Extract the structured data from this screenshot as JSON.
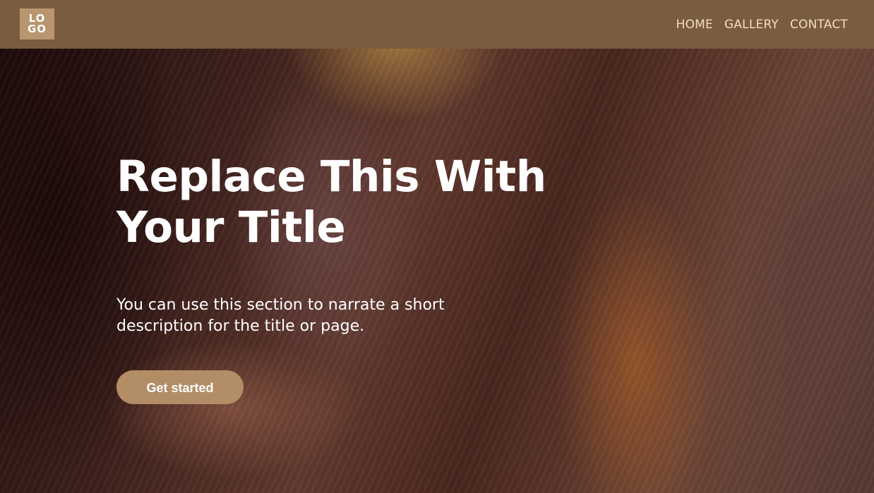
{
  "header": {
    "logo": {
      "line1": "LO",
      "line2": "GO"
    },
    "nav": [
      {
        "label": "HOME"
      },
      {
        "label": "GALLERY"
      },
      {
        "label": "CONTACT"
      }
    ]
  },
  "hero": {
    "title": "Replace This With Your Title",
    "description": "You can use this section to narrate a short description for the title or page.",
    "cta_label": "Get started"
  },
  "colors": {
    "header_bg": "#7a5c3f",
    "logo_bg": "#b79670",
    "nav_text": "#f0ddc5",
    "button_bg": "#b38d66",
    "text": "#ffffff"
  },
  "icons": {
    "logo": "logo-mark"
  }
}
